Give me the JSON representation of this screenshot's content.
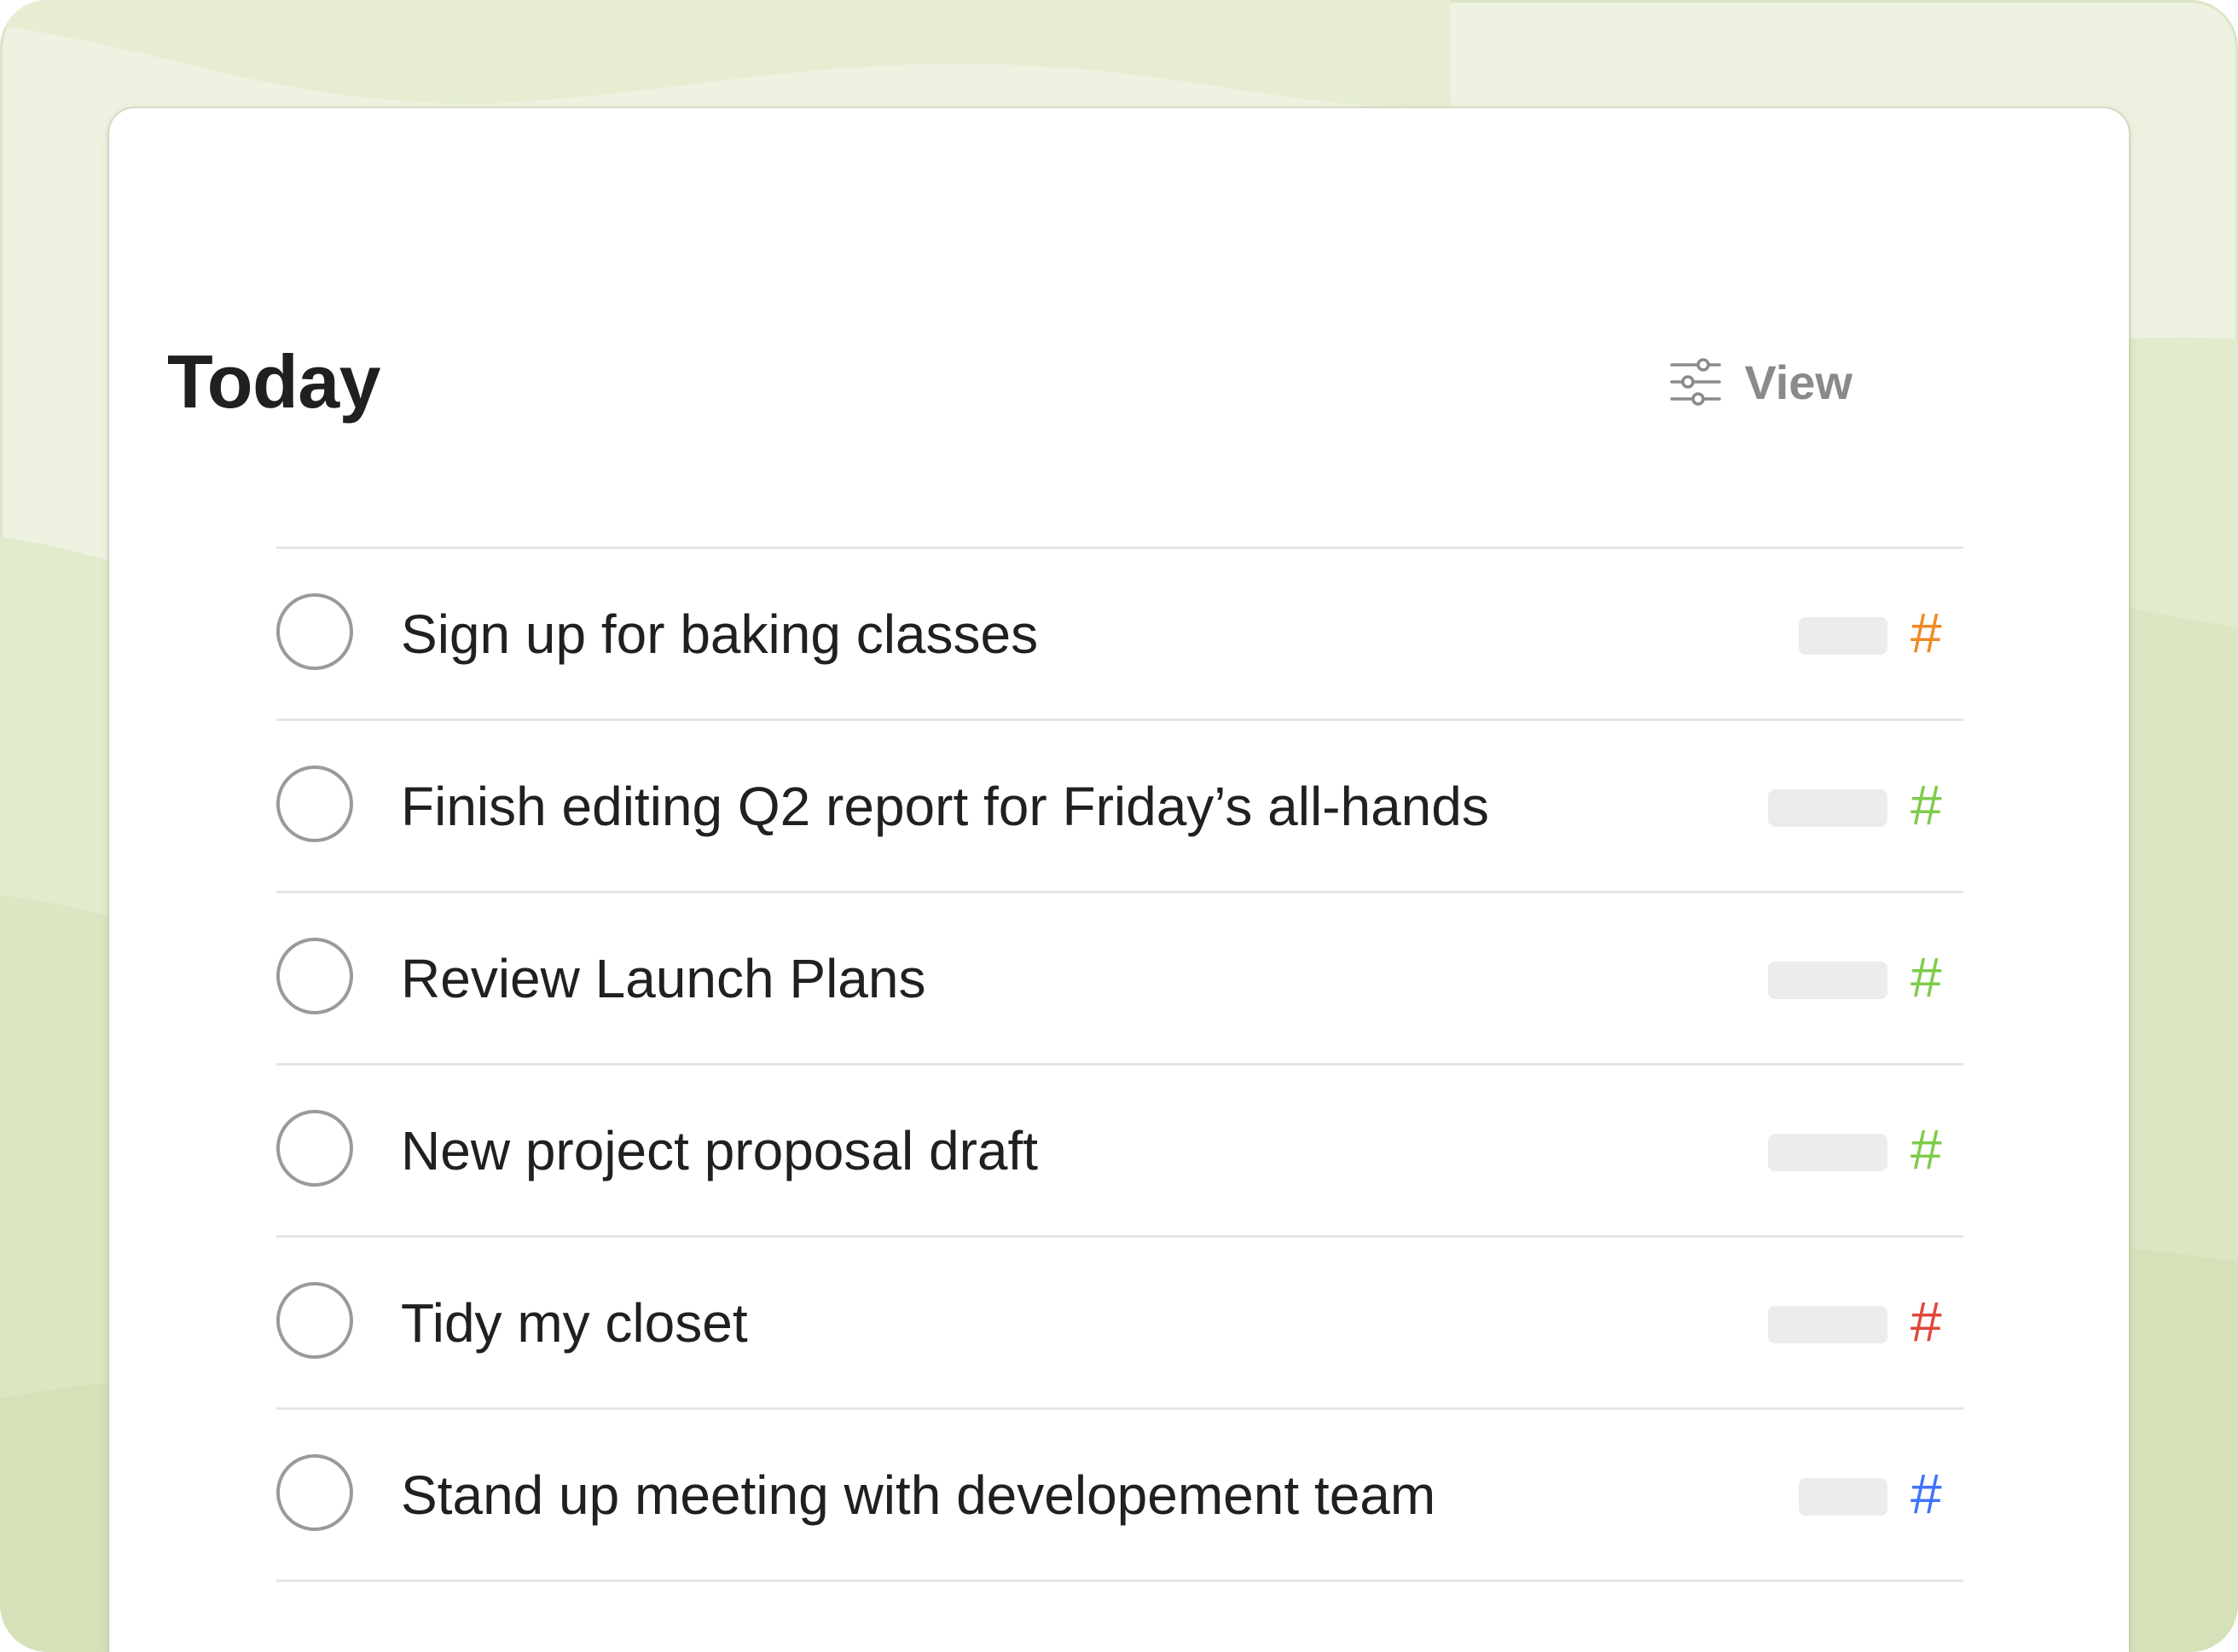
{
  "header": {
    "title": "Today",
    "view_label": "View",
    "view_icon": "sliders-icon"
  },
  "tasks": [
    {
      "text": "Sign up for baking classes",
      "tag": "#",
      "tag_color": "#f08a24",
      "pill": "short"
    },
    {
      "text": "Finish editing Q2 report for Friday’s all-hands",
      "tag": "#",
      "tag_color": "#7ecc49",
      "pill": "long"
    },
    {
      "text": "Review Launch Plans",
      "tag": "#",
      "tag_color": "#7ecc49",
      "pill": "long"
    },
    {
      "text": "New project proposal draft",
      "tag": "#",
      "tag_color": "#7ecc49",
      "pill": "long"
    },
    {
      "text": "Tidy my closet",
      "tag": "#",
      "tag_color": "#e0473a",
      "pill": "long"
    },
    {
      "text": "Stand up meeting with developement team",
      "tag": "#",
      "tag_color": "#4073ff",
      "pill": "short"
    }
  ],
  "colors": {
    "background": "#eef2e0",
    "card": "#ffffff",
    "title_text": "#202020",
    "muted_text": "#8a8a8a",
    "divider": "#e5e5e5"
  }
}
